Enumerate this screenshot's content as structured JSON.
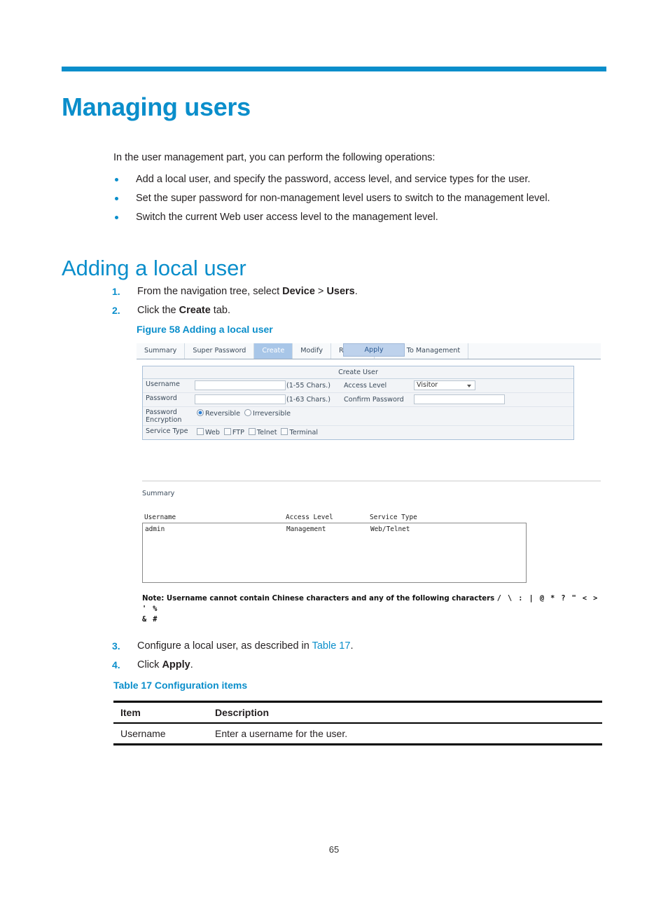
{
  "page": {
    "title": "Managing users",
    "section_title": "Adding a local user",
    "page_number": "65",
    "accent_color": "#0a8ecb"
  },
  "intro": {
    "text": "In the user management part, you can perform the following operations:",
    "bullets": [
      "Add a local user, and specify the password, access level, and service types for the user.",
      "Set the super password for non-management level users to switch to the management level.",
      "Switch the current Web user access level to the management level."
    ]
  },
  "steps_a": [
    {
      "num": "1.",
      "prefix": "From the navigation tree, select ",
      "bold1": "Device",
      "mid": " > ",
      "bold2": "Users",
      "suffix": "."
    },
    {
      "num": "2.",
      "prefix": "Click the ",
      "bold1": "Create",
      "mid": "",
      "bold2": "",
      "suffix": " tab."
    }
  ],
  "steps_b": [
    {
      "num": "3.",
      "prefix": "Configure a local user, as described in ",
      "link": "Table 17",
      "suffix": "."
    },
    {
      "num": "4.",
      "prefix": "Click ",
      "bold1": "Apply",
      "suffix": "."
    }
  ],
  "figure": {
    "caption": "Figure 58 Adding a local user",
    "tabs": [
      {
        "label": "Summary",
        "active": false
      },
      {
        "label": "Super Password",
        "active": false
      },
      {
        "label": "Create",
        "active": true
      },
      {
        "label": "Modify",
        "active": false
      },
      {
        "label": "Remove",
        "active": false
      },
      {
        "label": "Switch To Management",
        "active": false
      }
    ],
    "form": {
      "title": "Create User",
      "username_label": "Username",
      "username_value": "",
      "username_hint": "(1-55 Chars.)",
      "access_level_label": "Access Level",
      "access_level_value": "Visitor",
      "password_label": "Password",
      "password_value": "",
      "password_hint": "(1-63 Chars.)",
      "confirm_password_label": "Confirm Password",
      "confirm_password_value": "",
      "password_encryption_label": "Password Encryption",
      "encryption_options": [
        {
          "label": "Reversible",
          "selected": true
        },
        {
          "label": "Irreversible",
          "selected": false
        }
      ],
      "service_type_label": "Service Type",
      "service_types": [
        {
          "label": "Web",
          "checked": false
        },
        {
          "label": "FTP",
          "checked": false
        },
        {
          "label": "Telnet",
          "checked": false
        },
        {
          "label": "Terminal",
          "checked": false
        }
      ],
      "apply_label": "Apply"
    },
    "summary": {
      "label": "Summary",
      "columns": [
        "Username",
        "Access Level",
        "Service Type"
      ],
      "rows": [
        {
          "username": "admin",
          "access_level": "Management",
          "service_type": "Web/Telnet"
        }
      ]
    },
    "note_line1": "Note: Username cannot contain Chinese characters and any of the following characters",
    "note_symbols1": "/ \\ : | @ * ? \" < > ' %",
    "note_symbols2": "& #"
  },
  "table17": {
    "caption": "Table 17 Configuration items",
    "columns": [
      "Item",
      "Description"
    ],
    "rows": [
      {
        "item": "Username",
        "description": "Enter a  username for the user."
      }
    ]
  }
}
